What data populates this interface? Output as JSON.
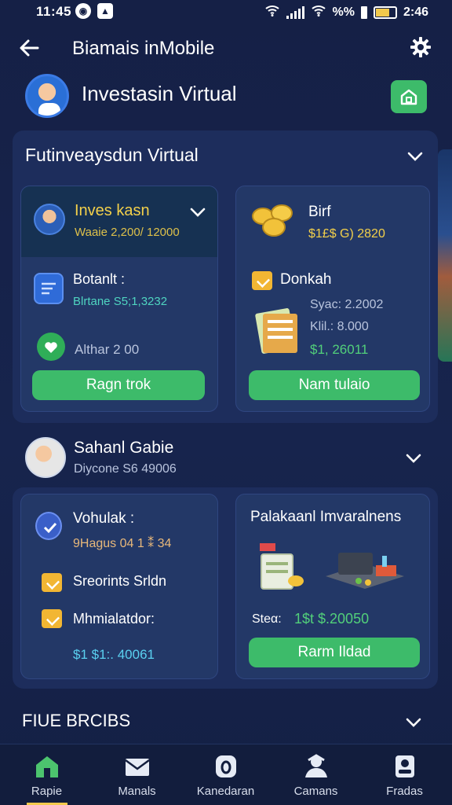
{
  "status_bar": {
    "time": "11:45",
    "battery_text": "%%",
    "right_time": "2:46"
  },
  "header": {
    "title": "Biamais inMobile"
  },
  "profile": {
    "name": "Investasin Virtual"
  },
  "section1": {
    "title": "Futinveaysdun Virtual",
    "card_a": {
      "head_title": "Inves kasn",
      "head_sub": "Waaie 2,200/ 12000",
      "row1_title": "Botanlt :",
      "row1_sub": "Blrtane S5;1,3232",
      "row2_text": "Althar 2 00",
      "button": "Ragn trok"
    },
    "card_b": {
      "title": "Birf",
      "value": "$1£$ G) 2820",
      "item_title": "Donkah",
      "line1": "Syac: 2.2002",
      "line2": "Klil.: 8.000",
      "line3": "$1, 26011",
      "button": "Nam tulaio"
    }
  },
  "person": {
    "name": "Sahanl Gabie",
    "sub": "Diycone S6 49006"
  },
  "section2": {
    "card_c": {
      "title": "Vohulak :",
      "sub": "9Hagus 04 1 ⁑ 34",
      "item1": "Sreorints Srldn",
      "item2": "Mhmialatdor:",
      "value": "$1 $1:. 40061"
    },
    "card_d": {
      "title": "Palakaanl Imvaralnens",
      "stat_label": "Steα:",
      "stat_value": "1$t $.20050",
      "button": "Rarm Ildad"
    }
  },
  "section3": {
    "title": "FIUE BRCIBS"
  },
  "nav": [
    {
      "label": "Rapie",
      "icon": "home-icon"
    },
    {
      "label": "Manals",
      "icon": "mail-icon"
    },
    {
      "label": "Kanedaran",
      "icon": "calendar-icon"
    },
    {
      "label": "Camans",
      "icon": "people-icon"
    },
    {
      "label": "Fradas",
      "icon": "profile-icon"
    }
  ],
  "colors": {
    "accent_green": "#3dbb6a",
    "accent_yellow": "#f3d04a",
    "background": "#152046"
  }
}
